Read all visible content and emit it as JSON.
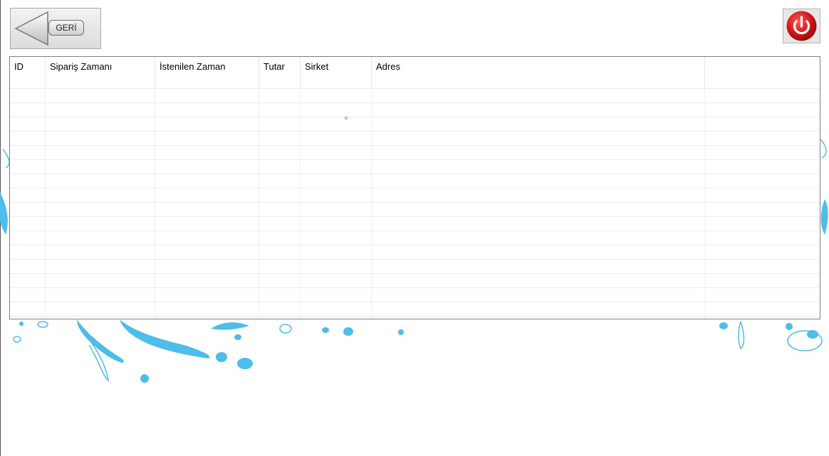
{
  "toolbar": {
    "back_label": "GERİ",
    "back_icon": "arrow-left-icon",
    "power_icon": "power-icon"
  },
  "grid": {
    "columns": [
      "ID",
      "Sipariş Zamanı",
      "İstenilen Zaman",
      "Tutar",
      "Sirket",
      "Adres",
      ""
    ],
    "rows": []
  },
  "theme": {
    "splash_color": "#4dbde9",
    "power_color": "#cc1515"
  }
}
